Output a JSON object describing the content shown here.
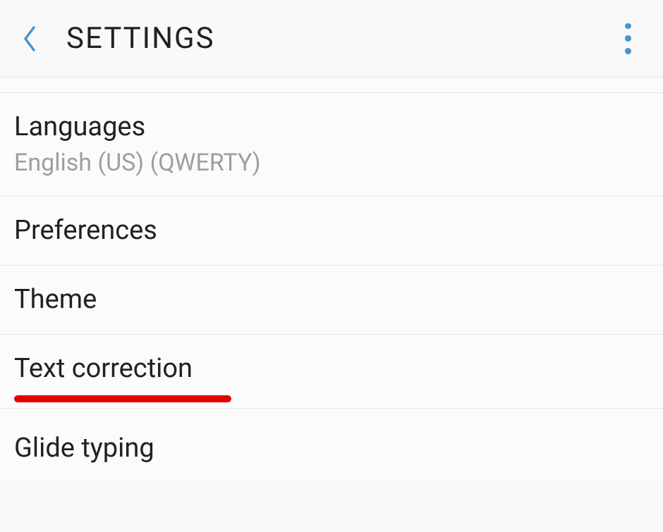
{
  "header": {
    "title": "SETTINGS"
  },
  "items": [
    {
      "title": "Languages",
      "subtitle": "English (US) (QWERTY)"
    },
    {
      "title": "Preferences"
    },
    {
      "title": "Theme"
    },
    {
      "title": "Text correction"
    },
    {
      "title": "Glide typing"
    }
  ],
  "colors": {
    "accent": "#4895cb",
    "highlight": "#e60000"
  }
}
